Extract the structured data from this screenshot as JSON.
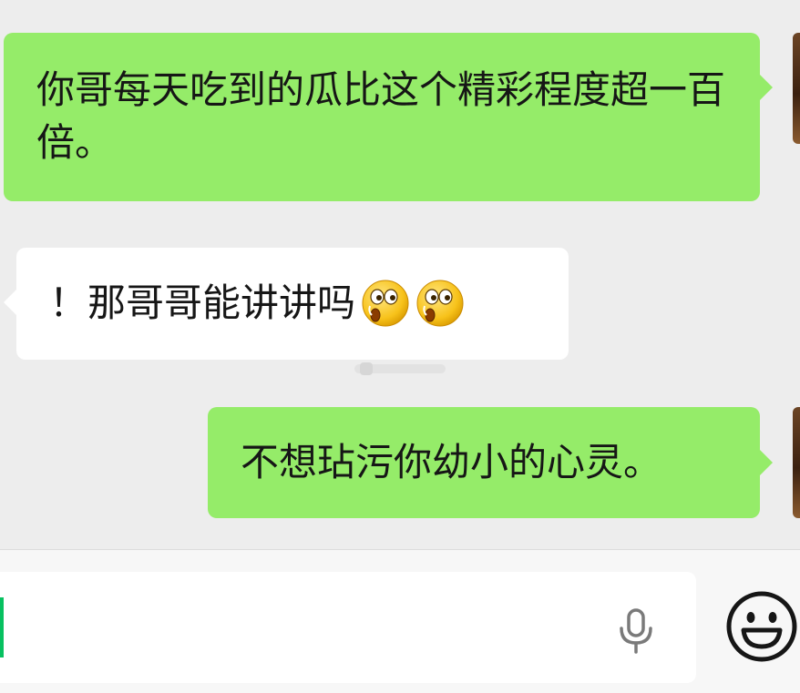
{
  "messages": [
    {
      "side": "sent",
      "text": "你哥每天吃到的瓜比这个精彩程度超一百倍。"
    },
    {
      "side": "received",
      "text": "！那哥哥能讲讲吗",
      "emoji": [
        "surprised-emoji",
        "surprised-emoji"
      ]
    },
    {
      "side": "sent",
      "text": "不想玷污你幼小的心灵。"
    }
  ],
  "colors": {
    "sent_bubble": "#95ec69",
    "received_bubble": "#ffffff",
    "background": "#ededed",
    "accent": "#07c160"
  },
  "input": {
    "value": "",
    "icons": [
      "microphone-icon",
      "emoji-smile-icon"
    ]
  }
}
